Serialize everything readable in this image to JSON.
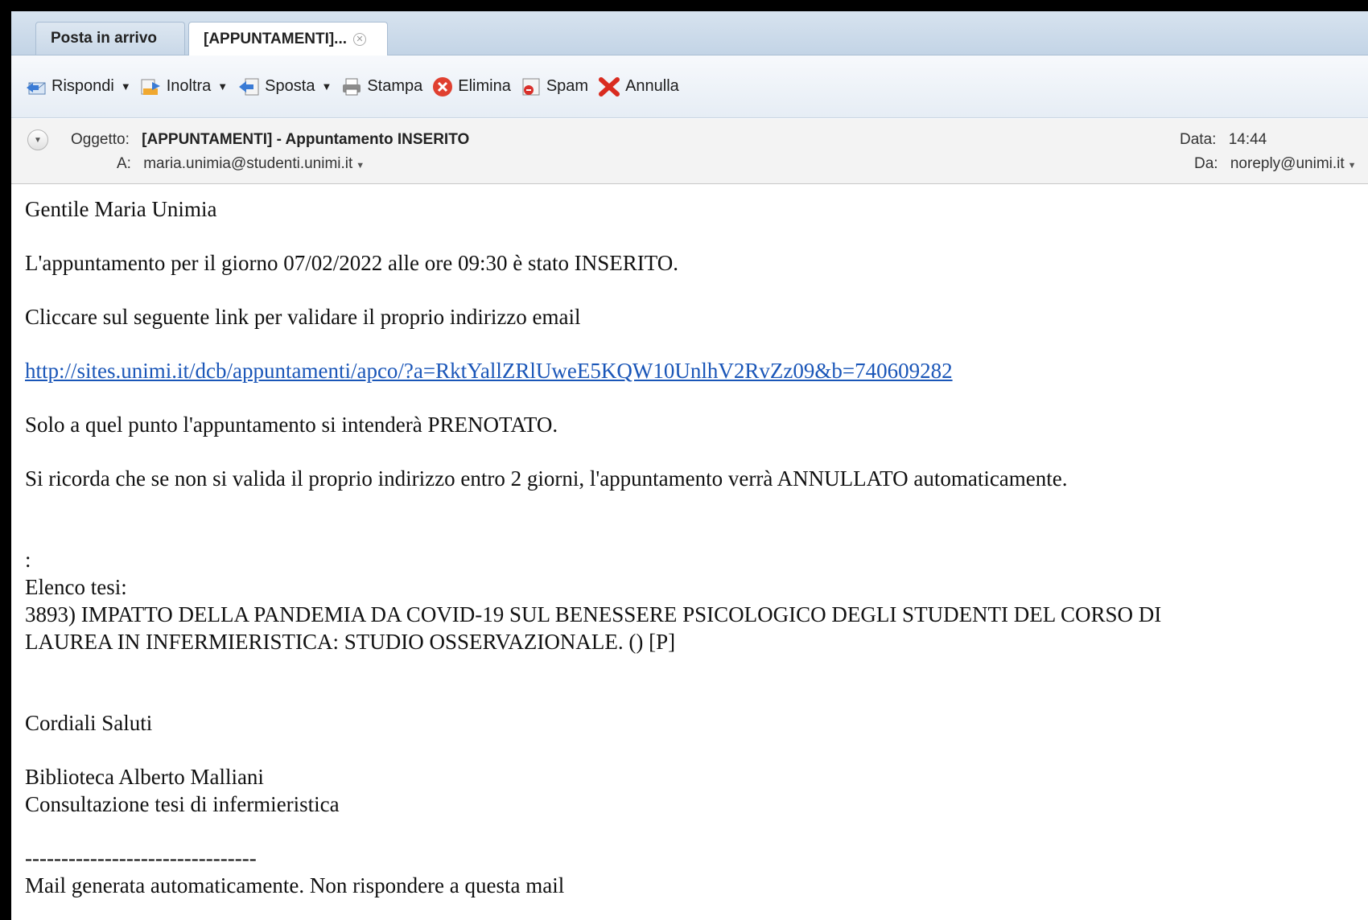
{
  "tabs": [
    {
      "label": "Posta in arrivo"
    },
    {
      "label": "[APPUNTAMENTI]..."
    }
  ],
  "toolbar": {
    "reply": "Rispondi",
    "forward": "Inoltra",
    "move": "Sposta",
    "print": "Stampa",
    "delete": "Elimina",
    "spam": "Spam",
    "cancel": "Annulla"
  },
  "header": {
    "subject_label": "Oggetto:",
    "subject": "[APPUNTAMENTI] - Appuntamento INSERITO",
    "to_label": "A:",
    "to": "maria.unimia@studenti.unimi.it",
    "date_label": "Data:",
    "date": "14:44",
    "from_label": "Da:",
    "from": "noreply@unimi.it"
  },
  "body": {
    "greeting": "Gentile Maria Unimia",
    "line1": "L'appuntamento per il giorno 07/02/2022 alle ore 09:30 è stato INSERITO.",
    "line2": "Cliccare sul seguente link per validare il proprio indirizzo email",
    "link": "http://sites.unimi.it/dcb/appuntamenti/apco/?a=RktYallZRlUweE5KQW10UnlhV2RvZz09&b=740609282",
    "line3": "Solo a quel punto l'appuntamento si intenderà PRENOTATO.",
    "line4": "Si ricorda che se non si valida il proprio indirizzo entro 2 giorni, l'appuntamento verrà ANNULLATO automaticamente.",
    "colon": ":",
    "list_title": "Elenco tesi:",
    "thesis_line1": "3893) IMPATTO DELLA PANDEMIA DA COVID-19 SUL BENESSERE PSICOLOGICO DEGLI STUDENTI DEL CORSO DI",
    "thesis_line2": "LAUREA IN INFERMIERISTICA: STUDIO OSSERVAZIONALE. () [P]",
    "closing": "Cordiali Saluti",
    "sign1": "Biblioteca Alberto Malliani",
    "sign2": "Consultazione tesi di infermieristica",
    "separator": "--------------------------------",
    "footer": "Mail generata automaticamente. Non rispondere a questa mail"
  }
}
